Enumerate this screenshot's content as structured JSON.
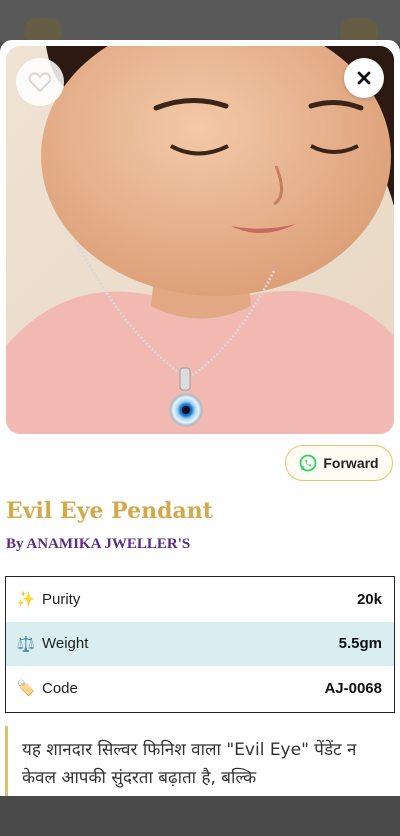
{
  "product": {
    "title": "Evil Eye Pendant",
    "byline": "By ANAMIKA JWELLER'S",
    "image_alt": "Girl wearing silver evil eye pendant necklace"
  },
  "actions": {
    "favorite_icon": "heart-outline-icon",
    "close_icon": "close-icon",
    "forward_label": "Forward",
    "forward_icon": "whatsapp-icon"
  },
  "specs": [
    {
      "icon": "✨",
      "label": "Purity",
      "value": "20k"
    },
    {
      "icon": "⚖️",
      "label": "Weight",
      "value": "5.5gm"
    },
    {
      "icon": "🏷️",
      "label": "Code",
      "value": "AJ-0068"
    }
  ],
  "description": "यह शानदार सिल्वर फिनिश वाला \"Evil Eye\" पेंडेंट न केवल आपकी सुंदरता बढ़ाता है, बल्कि",
  "colors": {
    "title": "#d4a94a",
    "byline": "#5a2a86",
    "row_alt": "#d8eef0",
    "accent_border": "#e4c66a",
    "whatsapp": "#25d366"
  }
}
